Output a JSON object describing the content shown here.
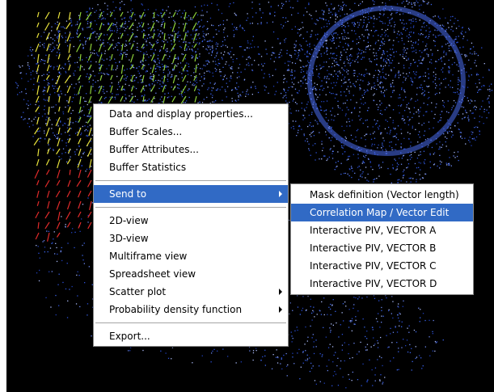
{
  "context_menu": {
    "items": [
      {
        "label": "Data and display properties..."
      },
      {
        "label": "Buffer Scales..."
      },
      {
        "label": "Buffer Attributes..."
      },
      {
        "label": "Buffer Statistics"
      },
      {
        "label": "Send to",
        "highlighted": true,
        "has_submenu": true
      },
      {
        "label": "2D-view"
      },
      {
        "label": "3D-view"
      },
      {
        "label": "Multiframe view"
      },
      {
        "label": "Spreadsheet view"
      },
      {
        "label": "Scatter plot",
        "has_submenu": true
      },
      {
        "label": "Probability density function",
        "has_submenu": true
      },
      {
        "label": "Export..."
      }
    ]
  },
  "send_to_submenu": {
    "items": [
      {
        "label": "Mask definition (Vector length)"
      },
      {
        "label": "Correlation Map / Vector Edit",
        "highlighted": true
      },
      {
        "label": "Interactive PIV, VECTOR A"
      },
      {
        "label": "Interactive PIV, VECTOR B"
      },
      {
        "label": "Interactive PIV, VECTOR C"
      },
      {
        "label": "Interactive PIV, VECTOR D"
      }
    ]
  },
  "colors": {
    "background": "#000000",
    "particles": "#2b4fd8",
    "vectors_green": "#8ed23a",
    "vectors_yellow": "#e8e23c",
    "vectors_red": "#e02a2a",
    "menu_highlight": "#316ac5"
  }
}
